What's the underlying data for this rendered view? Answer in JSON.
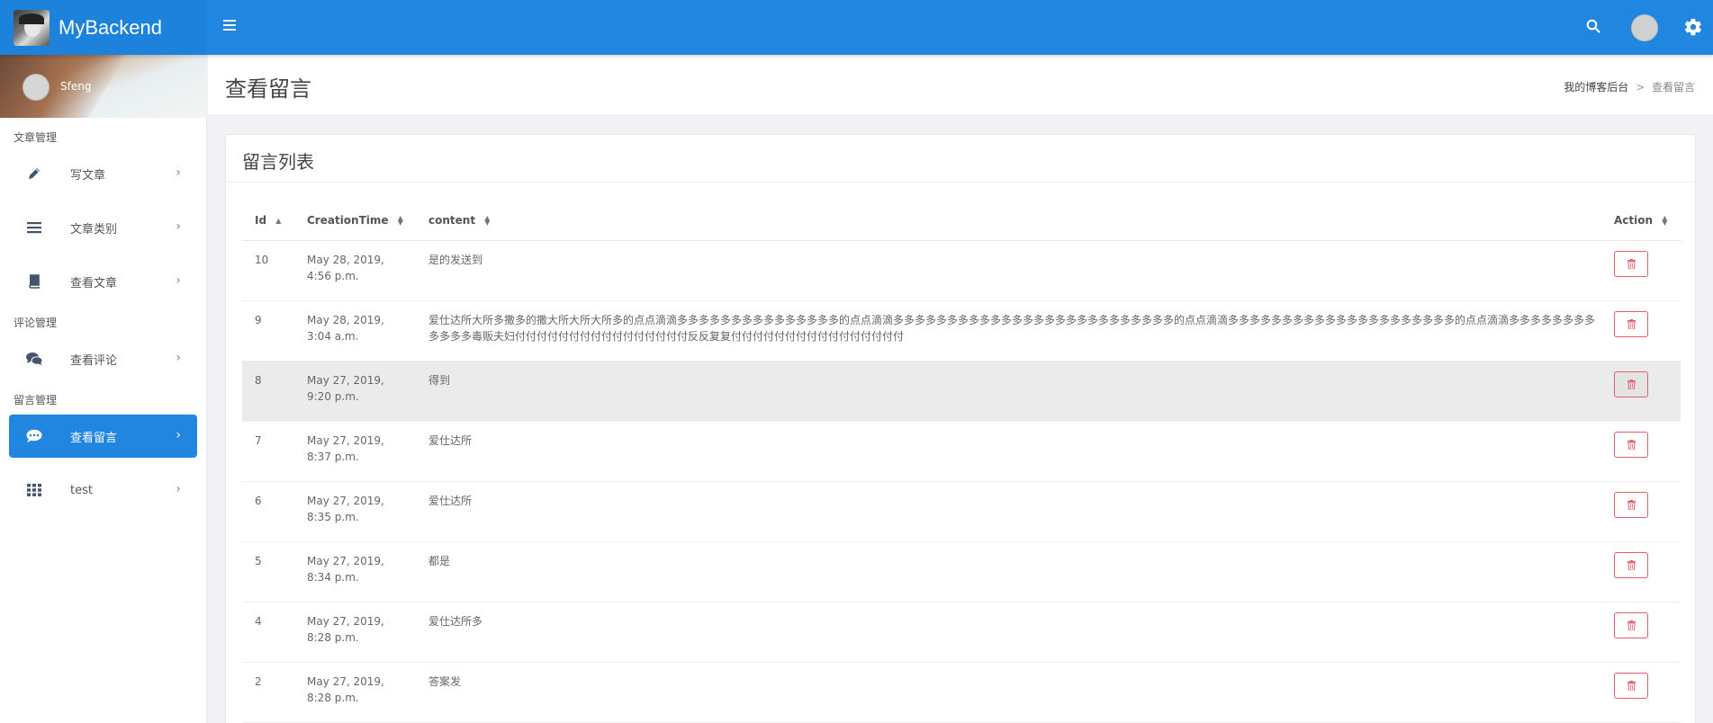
{
  "app": {
    "brand": "MyBackend"
  },
  "topbar": {
    "menu_icon": "hamburger-icon",
    "search_icon": "search-icon",
    "settings_icon": "gear-icon"
  },
  "user": {
    "name": "Sfeng"
  },
  "sidebar": {
    "sections": [
      {
        "header": "文章管理",
        "items": [
          {
            "label": "写文章",
            "icon": "pencil-icon"
          },
          {
            "label": "文章类别",
            "icon": "list-icon"
          },
          {
            "label": "查看文章",
            "icon": "book-icon"
          }
        ]
      },
      {
        "header": "评论管理",
        "items": [
          {
            "label": "查看评论",
            "icon": "comments-icon"
          }
        ]
      },
      {
        "header": "留言管理",
        "items": [
          {
            "label": "查看留言",
            "icon": "comment-dots-icon",
            "active": true
          },
          {
            "label": "test",
            "icon": "grid-icon"
          }
        ]
      }
    ]
  },
  "page": {
    "title": "查看留言",
    "breadcrumb": {
      "root": "我的博客后台",
      "separator": ">",
      "current": "查看留言"
    }
  },
  "card": {
    "title": "留言列表"
  },
  "table": {
    "headers": {
      "id": "Id",
      "time": "CreationTime",
      "content": "content",
      "action": "Action"
    },
    "rows": [
      {
        "id": "10",
        "time1": "May 28, 2019,",
        "time2": "4:56 p.m.",
        "content": "是的发送到"
      },
      {
        "id": "9",
        "time1": "May 28, 2019,",
        "time2": "3:04 a.m.",
        "content": "爱仕达所大所多撒多的撒大所大所大所多的点点滴滴多多多多多多多多多多多多多多多的点点滴滴多多多多多多多多多多多多多多多多多多多多多多多多多多的点点滴滴多多多多多多多多多多多多多多多多多多多多多的点点滴滴多多多多多多多多多多多多毒贩夫妇付付付付付付付付付付付付付付付付反反复复付付付付付付付付付付付付付付付付"
      },
      {
        "id": "8",
        "time1": "May 27, 2019,",
        "time2": "9:20 p.m.",
        "content": "得到"
      },
      {
        "id": "7",
        "time1": "May 27, 2019,",
        "time2": "8:37 p.m.",
        "content": "爱仕达所"
      },
      {
        "id": "6",
        "time1": "May 27, 2019,",
        "time2": "8:35 p.m.",
        "content": "爱仕达所"
      },
      {
        "id": "5",
        "time1": "May 27, 2019,",
        "time2": "8:34 p.m.",
        "content": "都是"
      },
      {
        "id": "4",
        "time1": "May 27, 2019,",
        "time2": "8:28 p.m.",
        "content": "爱仕达所多"
      },
      {
        "id": "2",
        "time1": "May 27, 2019,",
        "time2": "8:28 p.m.",
        "content": "答案发"
      }
    ],
    "highlight_row": "8",
    "delete_icon": "trash-icon"
  },
  "colors": {
    "primary": "#2086e0",
    "danger": "#e35d6a"
  }
}
